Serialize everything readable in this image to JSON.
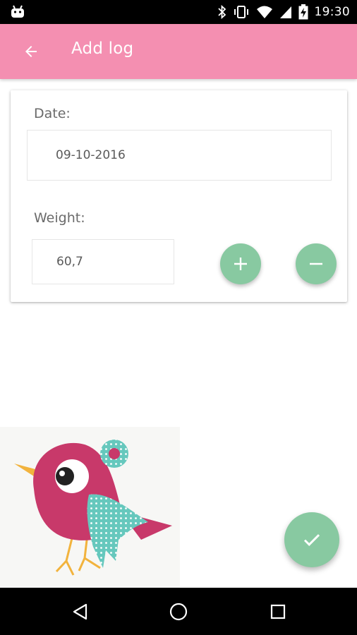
{
  "status_bar": {
    "time": "19:30",
    "icons": [
      "android-icon",
      "bluetooth-icon",
      "vibrate-icon",
      "wifi-icon",
      "signal-icon",
      "battery-charging-icon"
    ]
  },
  "app_bar": {
    "title": "Add log",
    "back_icon": "arrow-back-icon",
    "background_color": "#f48fb1"
  },
  "form": {
    "date_label": "Date:",
    "date_value": "09-10-2016",
    "weight_label": "Weight:",
    "weight_value": "60,7",
    "increment_icon": "plus-icon",
    "decrement_icon": "minus-icon",
    "accent_color": "#88c9a1"
  },
  "fab": {
    "icon": "check-icon"
  },
  "nav_bar": {
    "icons": [
      "nav-back-icon",
      "nav-home-icon",
      "nav-recents-icon"
    ]
  }
}
